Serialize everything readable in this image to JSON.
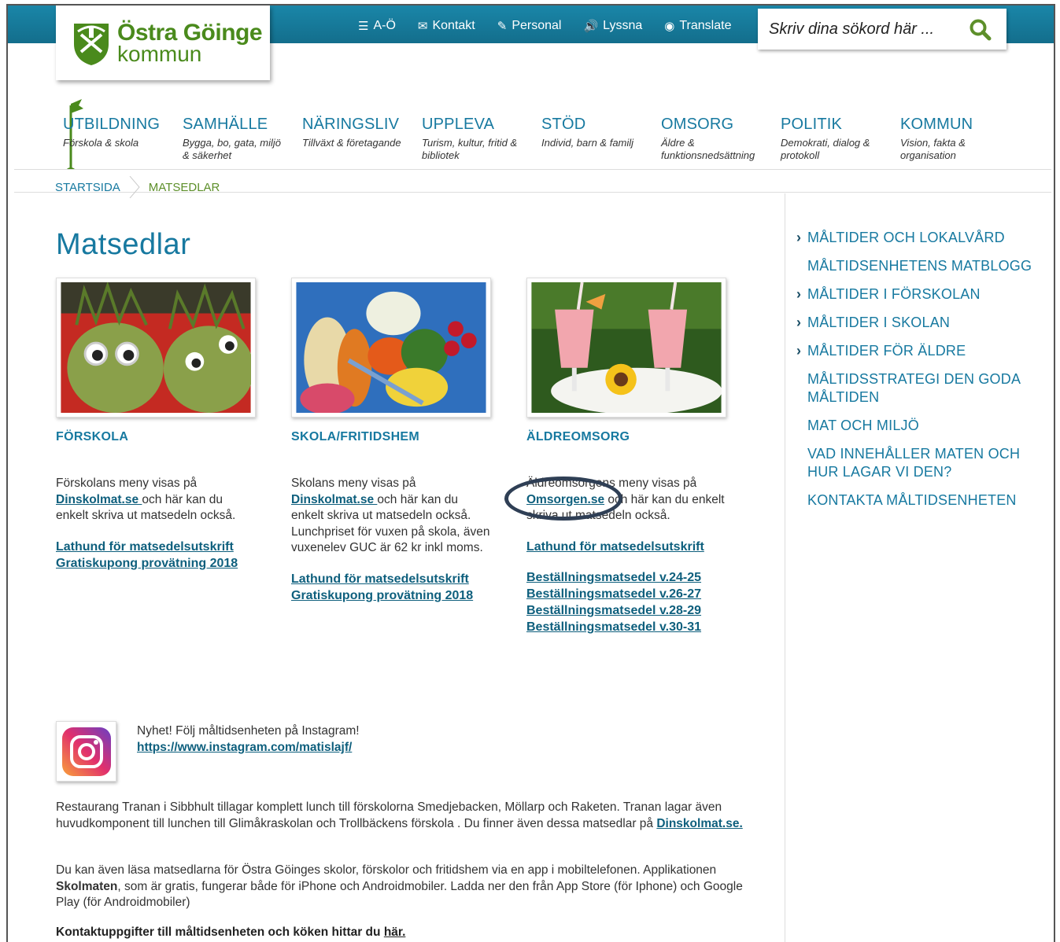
{
  "logo": {
    "name": "Östra Göinge",
    "sub": "kommun"
  },
  "tools": [
    {
      "label": "A-Ö",
      "icon": "list-icon"
    },
    {
      "label": "Kontakt",
      "icon": "mail-icon"
    },
    {
      "label": "Personal",
      "icon": "pen-icon"
    },
    {
      "label": "Lyssna",
      "icon": "speaker-icon"
    },
    {
      "label": "Translate",
      "icon": "globe-icon"
    }
  ],
  "search": {
    "placeholder": "Skriv dina sökord här ..."
  },
  "nav": [
    {
      "title": "UTBILDNING",
      "sub": "Förskola & skola"
    },
    {
      "title": "SAMHÄLLE",
      "sub": "Bygga, bo, gata, miljö & säkerhet"
    },
    {
      "title": "NÄRINGSLIV",
      "sub": "Tillväxt & företagande"
    },
    {
      "title": "UPPLEVA",
      "sub": "Turism, kultur, fritid & bibliotek"
    },
    {
      "title": "STÖD",
      "sub": "Individ, barn & familj"
    },
    {
      "title": "OMSORG",
      "sub": "Äldre & funktionsnedsättning"
    },
    {
      "title": "POLITIK",
      "sub": "Demokrati, dialog & protokoll"
    },
    {
      "title": "KOMMUN",
      "sub": "Vision, fakta & organisation"
    }
  ],
  "breadcrumb": {
    "home": "STARTSIDA",
    "current": "MATSEDLAR"
  },
  "page_title": "Matsedlar",
  "cards": {
    "forskola": {
      "heading": "FÖRSKOLA",
      "text_before": "Förskolans meny visas på ",
      "link": "Dinskolmat.se ",
      "text_after": "och här kan du enkelt skriva ut matsedeln också.",
      "links": [
        "Lathund för matsedelsutskrift",
        "Gratiskupong provätning 2018"
      ]
    },
    "skola": {
      "heading": "SKOLA/FRITIDSHEM",
      "text_before": "Skolans meny visas på ",
      "link": "Dinskolmat.se ",
      "text_after": "och här kan du enkelt skriva ut matsedeln också. Lunchpriset för vuxen på skola, även vuxenelev GUC är 62 kr inkl moms.",
      "links": [
        "Lathund för matsedelsutskrift",
        "Gratiskupong provätning 2018"
      ]
    },
    "aldre": {
      "heading": "ÄLDREOMSORG",
      "text_before": "Äldreomsorgens meny visas på ",
      "link": "Omsorgen.se",
      "text_after": " och här kan du enkelt skriva ut matsedeln också.",
      "links": [
        "Lathund för matsedelsutskrift ",
        "Beställningsmatsedel v.24-25",
        "Beställningsmatsedel v.26-27",
        "Beställningsmatsedel v.28-29",
        "Beställningsmatsedel v.30-31"
      ]
    }
  },
  "sidebar": [
    {
      "label": "MÅLTIDER OCH LOKALVÅRD",
      "chevron": true
    },
    {
      "label": "MÅLTIDSENHETENS MATBLOGG",
      "chevron": false
    },
    {
      "label": "MÅLTIDER I FÖRSKOLAN",
      "chevron": true
    },
    {
      "label": "MÅLTIDER I SKOLAN",
      "chevron": true
    },
    {
      "label": "MÅLTIDER FÖR ÄLDRE",
      "chevron": true
    },
    {
      "label": "MÅLTIDSSTRATEGI DEN GODA MÅLTIDEN",
      "chevron": false
    },
    {
      "label": "MAT OCH MILJÖ",
      "chevron": false
    },
    {
      "label": "VAD INNEHÅLLER MATEN OCH HUR LAGAR VI DEN?",
      "chevron": false
    },
    {
      "label": "KONTAKTA MÅLTIDSENHETEN",
      "chevron": false
    }
  ],
  "instagram": {
    "text": "Nyhet! Följ måltidsenheten på Instagram!",
    "link": "https://www.instagram.com/matislajf/"
  },
  "para1": {
    "text": "Restaurang Tranan i Sibbhult tillagar komplett lunch till förskolorna Smedjebacken, Möllarp och Raketen. Tranan lagar även huvudkomponent till lunchen till Glimåkraskolan och Trollbäckens förskola . Du finner även dessa matsedlar på ",
    "link": "Dinskolmat.se."
  },
  "para2": {
    "before": "Du kan även läsa matsedlarna för Östra Göinges skolor, förskolor och fritidshem via en app i mobiltelefonen. Applikationen ",
    "bold": "Skolmaten",
    "after": ", som är gratis, fungerar både för iPhone och Androidmobiler. Ladda ner den från App Store (för Iphone) och Google Play (för Androidmobiler)"
  },
  "contact": {
    "text": "Kontaktuppgifter till måltidsenheten och köken hittar du ",
    "link": "här."
  },
  "colors": {
    "topbar": "#1a86a8",
    "brand_green": "#4a8a1c",
    "link_blue": "#1779a0",
    "annotation_circle": "#2f3f55"
  }
}
